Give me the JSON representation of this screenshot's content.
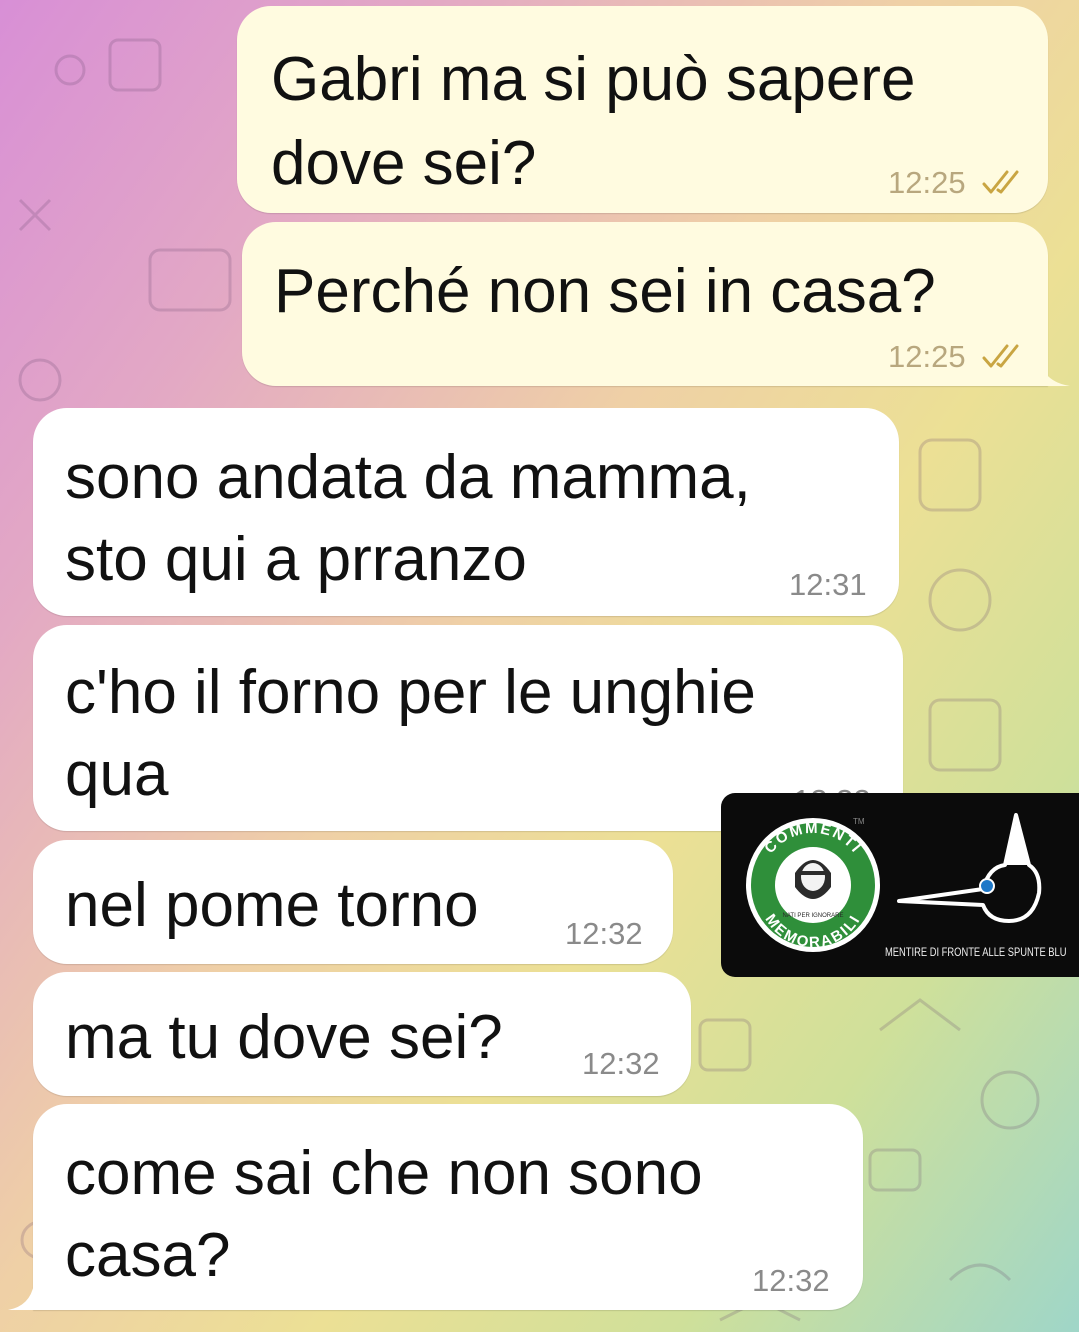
{
  "messages": [
    {
      "direction": "outgoing",
      "lines": [
        "Gabri ma si può sapere",
        "dove sei?"
      ],
      "time": "12:25",
      "status": "read"
    },
    {
      "direction": "outgoing",
      "lines": [
        "Perché non sei in casa?"
      ],
      "time": "12:25",
      "status": "read"
    },
    {
      "direction": "incoming",
      "lines": [
        "sono andata da mamma,",
        "sto qui a prranzo"
      ],
      "time": "12:31"
    },
    {
      "direction": "incoming",
      "lines": [
        "c'ho il forno per le unghie",
        "qua"
      ],
      "time": "12:32"
    },
    {
      "direction": "incoming",
      "lines": [
        "nel pome torno"
      ],
      "time": "12:32"
    },
    {
      "direction": "incoming",
      "lines": [
        "ma tu dove sei?"
      ],
      "time": "12:32"
    },
    {
      "direction": "incoming",
      "lines": [
        "come sai che non sono",
        "casa?"
      ],
      "time": "12:32"
    }
  ],
  "watermark": {
    "logo_text_top": "COMMENTI",
    "logo_text_bottom": "MEMORABILI",
    "logo_inner_text": "NATI PER IGNORARE",
    "trademark": "TM",
    "caption": "MENTIRE DI FRONTE ALLE SPUNTE BLU"
  },
  "colors": {
    "outgoing_bubble": "#fffbe0",
    "incoming_bubble": "#ffffff",
    "tick_color": "#c9a542",
    "logo_green": "#2f8f3a"
  }
}
